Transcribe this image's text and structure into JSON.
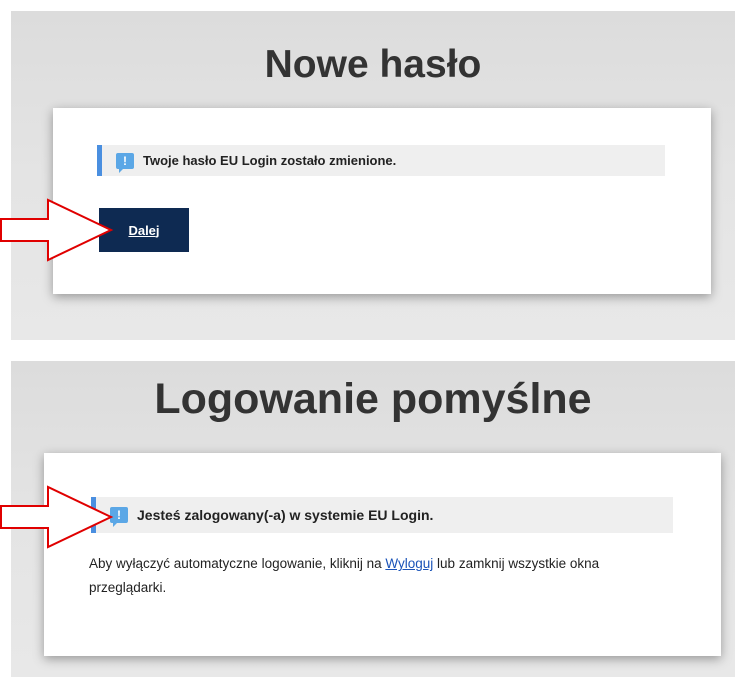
{
  "password_page": {
    "title": "Nowe hasło",
    "message": "Twoje hasło EU Login zostało zmienione.",
    "next_label": "Dalej"
  },
  "login_page": {
    "title": "Logowanie pomyślne",
    "message": "Jesteś zalogowany(-a) w systemie EU Login.",
    "text_before": "Aby wyłączyć automatyczne logowanie, kliknij na ",
    "logout_link": "Wyloguj",
    "text_after": " lub zamknij wszystkie okna przeglądarki."
  },
  "colors": {
    "button": "#0e2a52",
    "message_border": "#4a8fe0",
    "info_icon": "#5ba7e6",
    "arrow": "#e00000",
    "link": "#1a53b8"
  },
  "icons": [
    "info-icon",
    "arrow-pointer-icon"
  ]
}
